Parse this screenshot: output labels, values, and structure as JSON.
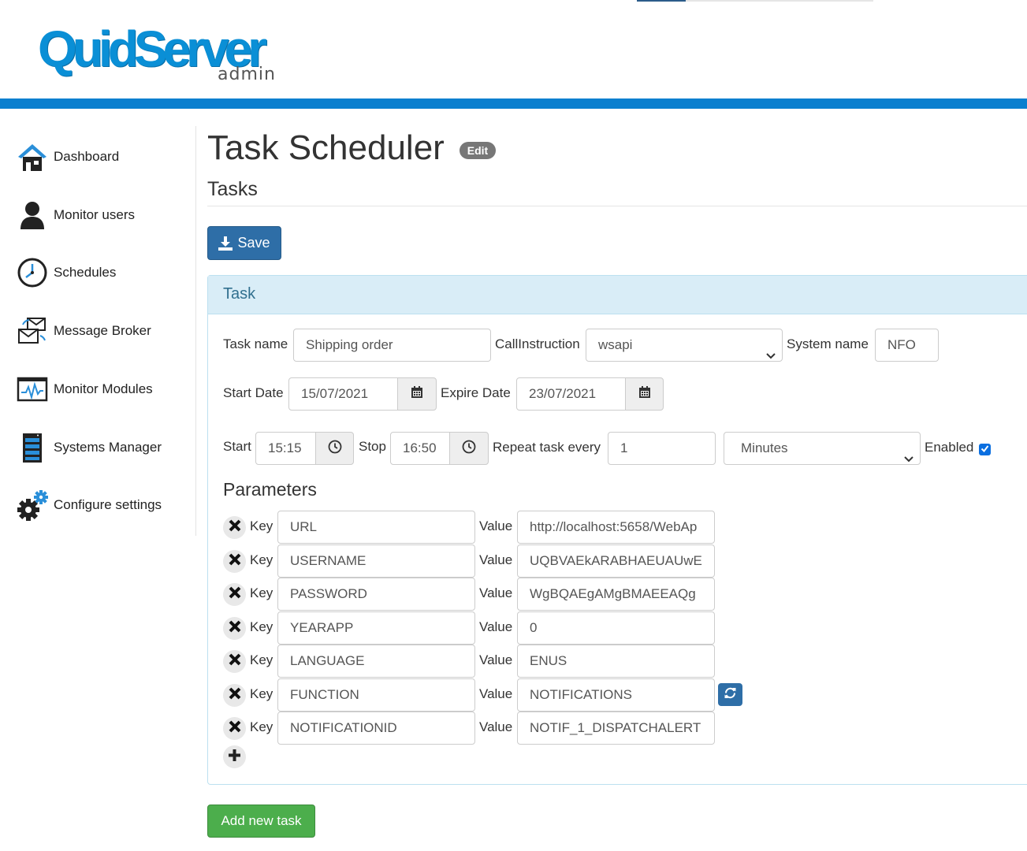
{
  "brand": {
    "name": "QuidServer",
    "sub": "admin"
  },
  "sidebar": {
    "items": [
      {
        "label": "Dashboard",
        "icon": "house-icon"
      },
      {
        "label": "Monitor users",
        "icon": "user-icon"
      },
      {
        "label": "Schedules",
        "icon": "clock-icon"
      },
      {
        "label": "Message Broker",
        "icon": "envelopes-icon"
      },
      {
        "label": "Monitor Modules",
        "icon": "pulse-monitor-icon"
      },
      {
        "label": "Systems Manager",
        "icon": "server-rack-icon"
      },
      {
        "label": "Configure settings",
        "icon": "gears-icon"
      }
    ]
  },
  "page": {
    "title": "Task Scheduler",
    "edit_badge": "Edit",
    "section": "Tasks",
    "save_label": "Save",
    "add_task_label": "Add new task"
  },
  "task": {
    "panel_title": "Task",
    "task_name_label": "Task name",
    "task_name": "Shipping order",
    "call_instruction_label": "CallInstruction",
    "call_instruction": "wsapi",
    "system_name_label": "System name",
    "system_name": "NFO",
    "start_date_label": "Start Date",
    "start_date": "15/07/2021",
    "expire_date_label": "Expire Date",
    "expire_date": "23/07/2021",
    "start_label": "Start",
    "start_time": "15:15",
    "stop_label": "Stop",
    "stop_time": "16:50",
    "repeat_label": "Repeat task every",
    "repeat_value": "1",
    "repeat_unit": "Minutes",
    "enabled_label": "Enabled",
    "enabled": true
  },
  "parameters": {
    "heading": "Parameters",
    "key_label": "Key",
    "value_label": "Value",
    "rows": [
      {
        "key": "URL",
        "value": "http://localhost:5658/WebAp"
      },
      {
        "key": "USERNAME",
        "value": "UQBVAEkARABHAEUAUwE"
      },
      {
        "key": "PASSWORD",
        "value": "WgBQAEgAMgBMAEEAQg"
      },
      {
        "key": "YEARAPP",
        "value": "0"
      },
      {
        "key": "LANGUAGE",
        "value": "ENUS"
      },
      {
        "key": "FUNCTION",
        "value": "NOTIFICATIONS"
      },
      {
        "key": "NOTIFICATIONID",
        "value": "NOTIF_1_DISPATCHALERT"
      }
    ]
  },
  "colors": {
    "brand_blue": "#0a7fcf",
    "primary_button": "#2e6ea7",
    "success_button": "#4cae4c",
    "panel_header": "#d9edf7"
  }
}
